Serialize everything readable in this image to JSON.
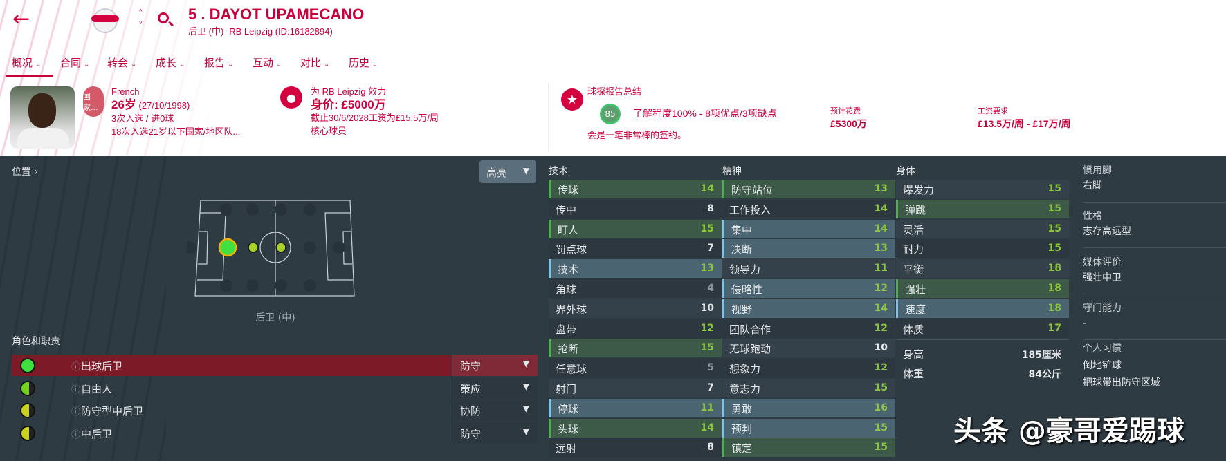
{
  "header": {
    "title": "5 . DAYOT UPAMECANO",
    "subtitle": "后卫 (中)- RB Leipzig (ID:16182894)"
  },
  "tabs": [
    {
      "label": "概况"
    },
    {
      "label": "合同"
    },
    {
      "label": "转会"
    },
    {
      "label": "成长"
    },
    {
      "label": "报告"
    },
    {
      "label": "互动"
    },
    {
      "label": "对比"
    },
    {
      "label": "历史"
    }
  ],
  "nation": {
    "badge": "国家...",
    "name": "French",
    "age": "26岁",
    "dob": "(27/10/1998)",
    "caps": "3次入选 / 进0球",
    "youth": "18次入选21岁以下国家/地区队..."
  },
  "club": {
    "plays_for": "为 RB Leipzig 效力",
    "value": "身价: £5000万",
    "contract": "截止30/6/2028工资为£15.5万/周",
    "status": "核心球员"
  },
  "scout": {
    "title": "球探报告总结",
    "rating": "85",
    "knowledge": "了解程度100% - 8项优点/3项缺点",
    "verdict": "会是一笔非常棒的签约。",
    "fee_label": "预计花费",
    "fee": "£5300万",
    "wage_label": "工资要求",
    "wage": "£13.5万/周 - £17万/周"
  },
  "position": {
    "label": "位置 ›",
    "highlight": "高亮",
    "pos_name": "后卫 (中)"
  },
  "roles": {
    "label": "角色和职责",
    "items": [
      {
        "name": "出球后卫",
        "duty": "防守",
        "color": "#3fe03f",
        "selected": true
      },
      {
        "name": "自由人",
        "duty": "策应",
        "color": "#74d31e",
        "selected": false
      },
      {
        "name": "防守型中后卫",
        "duty": "协防",
        "color": "#c8d41e",
        "selected": false
      },
      {
        "name": "中后卫",
        "duty": "防守",
        "color": "#c8d41e",
        "selected": false
      }
    ]
  },
  "attributes": {
    "technical": {
      "label": "技术",
      "items": [
        [
          "传球",
          14,
          "green"
        ],
        [
          "传中",
          8,
          ""
        ],
        [
          "盯人",
          15,
          "green"
        ],
        [
          "罚点球",
          7,
          ""
        ],
        [
          "技术",
          13,
          "blue"
        ],
        [
          "角球",
          4,
          ""
        ],
        [
          "界外球",
          10,
          ""
        ],
        [
          "盘带",
          12,
          ""
        ],
        [
          "抢断",
          15,
          "green"
        ],
        [
          "任意球",
          5,
          ""
        ],
        [
          "射门",
          7,
          ""
        ],
        [
          "停球",
          11,
          "blue"
        ],
        [
          "头球",
          14,
          "green"
        ],
        [
          "远射",
          8,
          ""
        ]
      ]
    },
    "mental": {
      "label": "精神",
      "items": [
        [
          "防守站位",
          13,
          "green"
        ],
        [
          "工作投入",
          14,
          ""
        ],
        [
          "集中",
          14,
          "blue"
        ],
        [
          "决断",
          13,
          "blue"
        ],
        [
          "领导力",
          11,
          ""
        ],
        [
          "侵略性",
          12,
          "blue"
        ],
        [
          "视野",
          14,
          "blue"
        ],
        [
          "团队合作",
          12,
          ""
        ],
        [
          "无球跑动",
          10,
          ""
        ],
        [
          "想象力",
          12,
          ""
        ],
        [
          "意志力",
          15,
          ""
        ],
        [
          "勇敢",
          16,
          "blue"
        ],
        [
          "预判",
          15,
          "blue"
        ],
        [
          "镇定",
          15,
          "green"
        ]
      ]
    },
    "physical": {
      "label": "身体",
      "items": [
        [
          "爆发力",
          15,
          ""
        ],
        [
          "弹跳",
          15,
          "green"
        ],
        [
          "灵活",
          15,
          ""
        ],
        [
          "耐力",
          15,
          ""
        ],
        [
          "平衡",
          18,
          ""
        ],
        [
          "强壮",
          18,
          "green"
        ],
        [
          "速度",
          18,
          "blue"
        ],
        [
          "体质",
          17,
          ""
        ]
      ]
    },
    "height_label": "身高",
    "height": "185厘米",
    "weight_label": "体重",
    "weight": "84公斤"
  },
  "details": {
    "foot_label": "惯用脚",
    "foot": "右脚",
    "personality_label": "性格",
    "personality": "志存高远型",
    "media_label": "媒体评价",
    "media": "强壮中卫",
    "gk_label": "守门能力",
    "gk": "-",
    "habits_label": "个人习惯",
    "habits": [
      "倒地铲球",
      "把球带出防守区域"
    ]
  },
  "watermark": "头条 @豪哥爱踢球",
  "colors": {
    "accent": "#c8003c",
    "panel": "#2f3b43",
    "green_hl": "#3d5a48",
    "blue_hl": "#4a6472"
  }
}
